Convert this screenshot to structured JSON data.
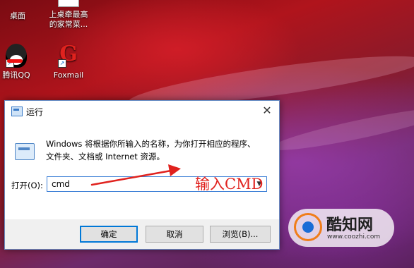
{
  "desktop": {
    "icons": [
      {
        "label": "桌面"
      },
      {
        "label1": "上桌牵最高",
        "label2": "的家常菜..."
      },
      {
        "label": "腾讯QQ"
      },
      {
        "label": "Foxmail"
      }
    ]
  },
  "dialog": {
    "title": "运行",
    "close_symbol": "✕",
    "desc_line1": "Windows 将根据你所输入的名称，为你打开相应的程序、",
    "desc_line2": "文件夹、文档或 Internet 资源。",
    "open_label": "打开(O):",
    "input_value": "cmd",
    "ok_label": "确定",
    "cancel_label": "取消",
    "browse_label": "浏览(B)..."
  },
  "annotation": {
    "text": "输入CMD",
    "color": "#e0221e"
  },
  "watermark": {
    "title": "酷知网",
    "url": "www.coozhi.com"
  }
}
